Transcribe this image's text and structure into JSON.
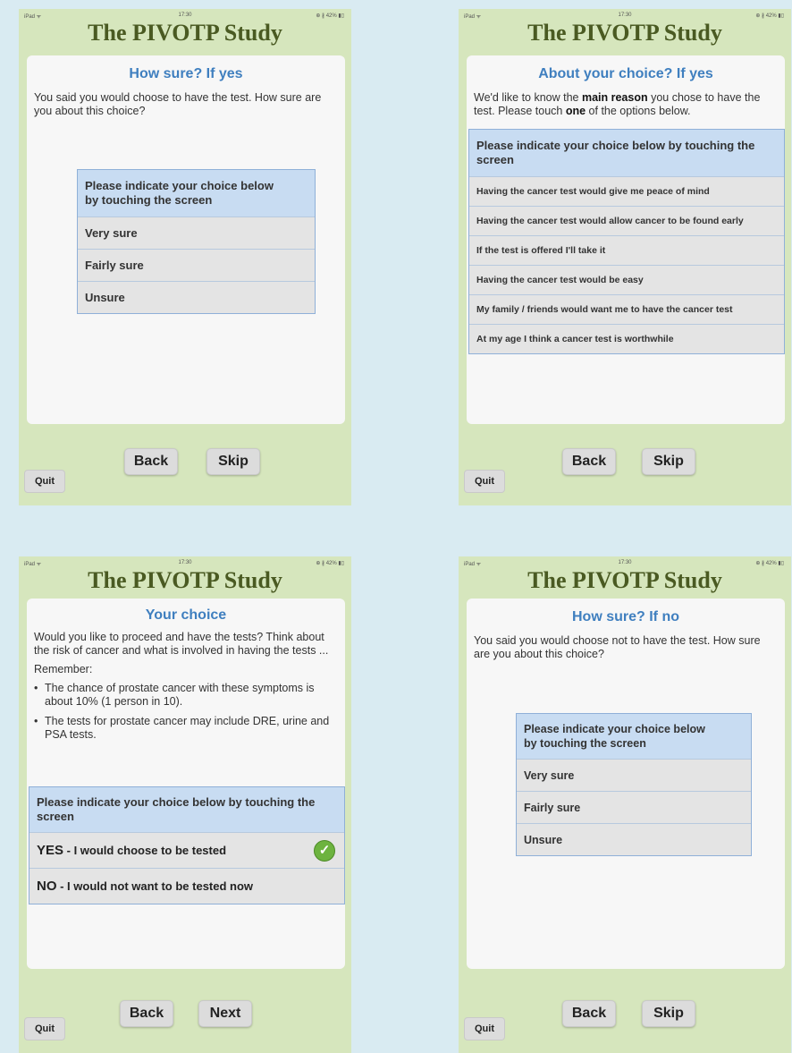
{
  "app_title": "The PIVOTP Study",
  "status": {
    "carrier": "iPad ᯤ",
    "time": "17:30",
    "battery": "⊕ ∦ 42% ▮▯"
  },
  "buttons": {
    "back": "Back",
    "skip": "Skip",
    "next": "Next",
    "quit": "Quit"
  },
  "screens": {
    "sure_yes": {
      "heading": "How sure? If yes",
      "text": "You said you would choose to have the test. How sure are you about this choice?",
      "prompt_line1": "Please indicate your choice below",
      "prompt_line2": "by touching the screen",
      "options": [
        "Very sure",
        "Fairly sure",
        "Unsure"
      ]
    },
    "about_yes": {
      "heading": "About your choice? If yes",
      "text_a": "We'd like to know the ",
      "text_bold1": "main reason",
      "text_b": " you chose to have the test. Please touch ",
      "text_bold2": "one",
      "text_c": " of the options below.",
      "prompt": "Please indicate your choice below by touching the screen",
      "options": [
        "Having the cancer test would give me peace of mind",
        "Having the cancer test would allow cancer to be found early",
        "If the test is offered I'll take it",
        "Having the cancer test would be easy",
        "My family / friends would want me to have the cancer test",
        "At my age I think a cancer test is worthwhile"
      ]
    },
    "your_choice": {
      "heading": "Your choice",
      "text": "Would you like to proceed and have the tests? Think about the risk of cancer and what is involved in having the tests ...",
      "remember": "Remember:",
      "bullets": [
        "The chance of prostate cancer with these symptoms is about 10% (1 person in 10).",
        "The tests for prostate cancer may include DRE, urine and PSA tests."
      ],
      "prompt": "Please indicate your choice below by touching the screen",
      "yes_key": "YES",
      "yes_rest": " - I would choose to be tested",
      "no_key": "NO",
      "no_rest": " - I would not want to be tested now",
      "selected": "YES"
    },
    "sure_no": {
      "heading": "How sure? If no",
      "text": "You said you would choose not to have the test. How sure are you about this choice?",
      "prompt_line1": "Please indicate your choice below",
      "prompt_line2": "by touching the screen",
      "options": [
        "Very sure",
        "Fairly sure",
        "Unsure"
      ]
    }
  }
}
